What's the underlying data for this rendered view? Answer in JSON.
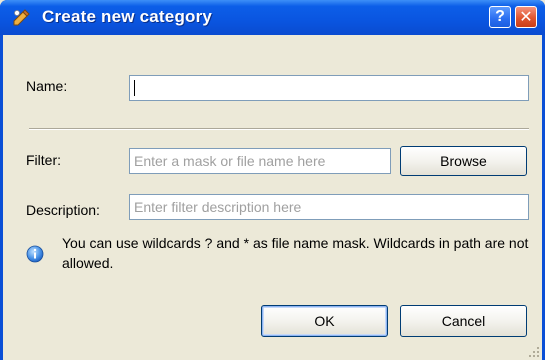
{
  "window": {
    "title": "Create new category",
    "icon": "category-pencil-icon",
    "help_glyph": "?",
    "close_glyph": "✕"
  },
  "form": {
    "name_label": "Name:",
    "name_value": "",
    "filter_label": "Filter:",
    "filter_value": "",
    "filter_placeholder": "Enter a mask or file name here",
    "browse_label": "Browse",
    "description_label": "Description:",
    "description_value": "",
    "description_placeholder": "Enter filter description here"
  },
  "info": {
    "icon": "info-icon",
    "text": "You can use wildcards ? and * as file name mask. Wildcards in path are not allowed."
  },
  "buttons": {
    "ok_label": "OK",
    "cancel_label": "Cancel"
  },
  "colors": {
    "titlebar": "#0a55e0",
    "dialog_bg": "#ece9d8",
    "input_border": "#7f9db9",
    "button_border": "#003c74",
    "close_button": "#e0552f"
  }
}
